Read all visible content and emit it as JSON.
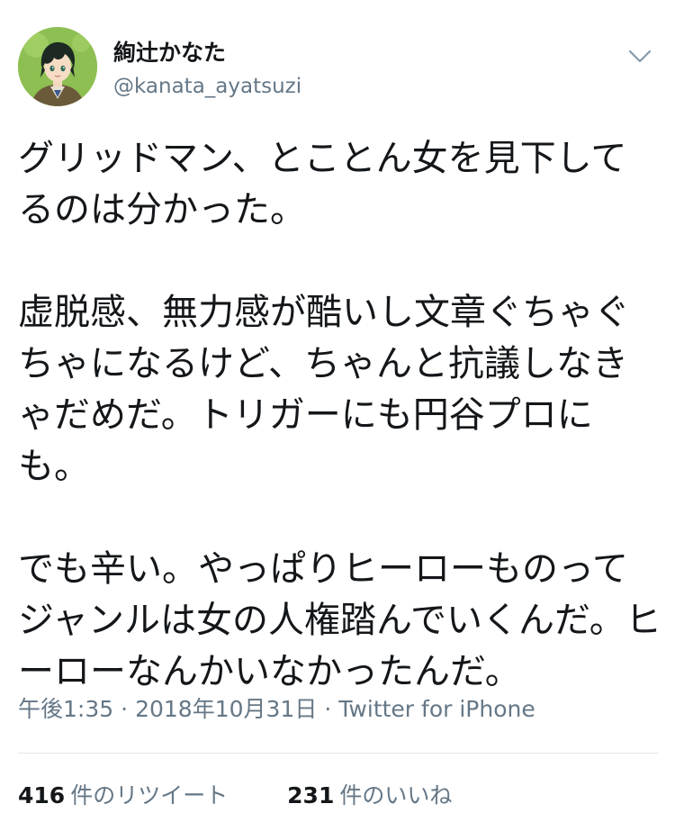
{
  "user": {
    "display_name": "絢辻かなた",
    "handle": "@kanata_ayatsuzi",
    "avatar_icon": "anime-character-avatar"
  },
  "tweet": {
    "text": "グリッドマン、とことん女を見下してるのは分かった。\n\n虚脱感、無力感が酷いし文章ぐちゃぐちゃになるけど、ちゃんと抗議しなきゃだめだ。トリガーにも円谷プロにも。\n\nでも辛い。やっぱりヒーローものってジャンルは女の人権踏んでいくんだ。ヒーローなんかいなかったんだ。"
  },
  "meta": {
    "time": "午後1:35",
    "date": "2018年10月31日",
    "source": "Twitter for iPhone",
    "separator": "·"
  },
  "stats": {
    "retweets_count": "416",
    "retweets_label": "件のリツイート",
    "likes_count": "231",
    "likes_label": "件のいいね"
  },
  "colors": {
    "text": "#14171a",
    "secondary": "#657786",
    "divider": "#e1e8ed",
    "avatar_bg": "#8dbf52"
  }
}
